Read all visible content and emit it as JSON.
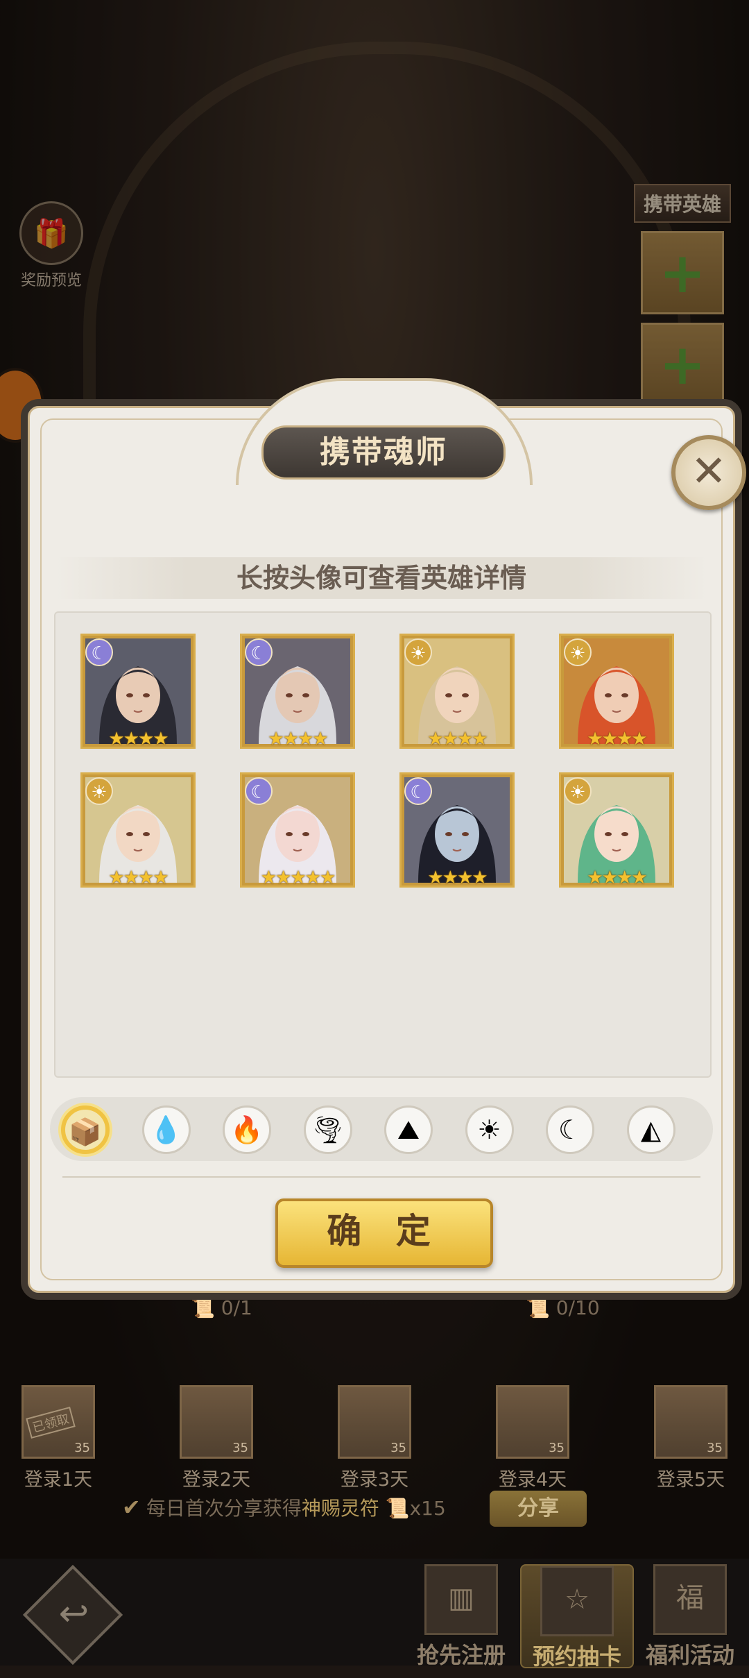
{
  "reward_preview": {
    "label": "奖励预览"
  },
  "carry_panel": {
    "title": "携带英雄"
  },
  "modal": {
    "title": "携带魂师",
    "subtitle": "长按头像可查看英雄详情",
    "confirm_label": "确 定",
    "close_symbol": "✕",
    "heroes": [
      {
        "element": "moon",
        "stars": 4,
        "hair": "#2a2a33",
        "skin": "#e8cbb5",
        "bg": "#5c5d6a"
      },
      {
        "element": "moon",
        "stars": 4,
        "hair": "#d8d8dc",
        "skin": "#e4c8b4",
        "bg": "#6a6570"
      },
      {
        "element": "sun",
        "stars": 4,
        "hair": "#d7c39a",
        "skin": "#f0d4bc",
        "bg": "#d9c080"
      },
      {
        "element": "sun",
        "stars": 4,
        "hair": "#d8542a",
        "skin": "#f0cdb5",
        "bg": "#c88a3c"
      },
      {
        "element": "sun",
        "stars": 4,
        "hair": "#e8e6e2",
        "skin": "#f2d8c4",
        "bg": "#d6c690"
      },
      {
        "element": "moon",
        "stars": 5,
        "hair": "#ece8ee",
        "skin": "#f3d8d2",
        "bg": "#c9b07e"
      },
      {
        "element": "moon",
        "stars": 4,
        "hair": "#1e1f2a",
        "skin": "#b8c6d6",
        "bg": "#6a6a78"
      },
      {
        "element": "sun",
        "stars": 4,
        "hair": "#5fb58a",
        "skin": "#f6dccb",
        "bg": "#d8cfa8"
      }
    ],
    "element_filters": [
      {
        "name": "all",
        "symbol": "📦"
      },
      {
        "name": "water",
        "symbol": "💧"
      },
      {
        "name": "fire",
        "symbol": "🔥"
      },
      {
        "name": "wind",
        "symbol": "🌪"
      },
      {
        "name": "earth",
        "symbol": "⛰"
      },
      {
        "name": "light",
        "symbol": "☀"
      },
      {
        "name": "moon",
        "symbol": "☾"
      },
      {
        "name": "arcane",
        "symbol": "◭"
      }
    ]
  },
  "progress": {
    "left": "0/1",
    "right": "0/10"
  },
  "login_rewards": [
    {
      "label": "登录1天",
      "count": "35",
      "claimed": "已领取"
    },
    {
      "label": "登录2天",
      "count": "35"
    },
    {
      "label": "登录3天",
      "count": "35"
    },
    {
      "label": "登录4天",
      "count": "35"
    },
    {
      "label": "登录5天",
      "count": "35"
    }
  ],
  "share": {
    "text_prefix": "每日首次分享获得",
    "highlight": "神赐灵符",
    "count": "x15",
    "button": "分享"
  },
  "bottom_nav": [
    {
      "label": "抢先注册",
      "icon": "▥"
    },
    {
      "label": "预约抽卡",
      "icon": "☆"
    },
    {
      "label": "福利活动",
      "icon": "福"
    }
  ],
  "colors": {
    "gold": "#e6b634",
    "moon": "#8a7fd6",
    "sun": "#d4a43c"
  }
}
